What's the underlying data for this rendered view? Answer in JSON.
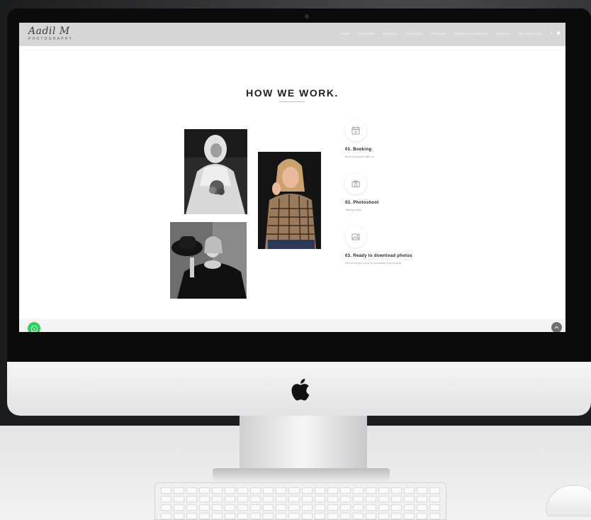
{
  "site": {
    "logo_script": "Aadil M",
    "logo_sub": "PHOTOGRAPHY"
  },
  "nav": {
    "items": [
      {
        "label": "HOME"
      },
      {
        "label": "OUR WORK"
      },
      {
        "label": "BOOKING"
      },
      {
        "label": "PACKAGES"
      },
      {
        "label": "ARTICLES"
      },
      {
        "label": "BEHIND THE CAMERA"
      },
      {
        "label": "CONTACT"
      },
      {
        "label": "TESTIMONIALS"
      }
    ],
    "social": [
      {
        "label": "f",
        "icon": "facebook-icon"
      },
      {
        "label": "▣",
        "icon": "instagram-icon"
      }
    ]
  },
  "section": {
    "title": "HOW WE WORK."
  },
  "steps": [
    {
      "title": "01.  Booking",
      "desc": "Book a session with us",
      "icon": "calendar-icon"
    },
    {
      "title": "02.  Photoshoot",
      "desc": "Taking action",
      "icon": "camera-icon"
    },
    {
      "title": "03.  Ready to download photos",
      "desc": "We email you a link to download your photos",
      "icon": "image-icon"
    }
  ],
  "photos": [
    {
      "name": "bride-photo",
      "desc": "black and white bride"
    },
    {
      "name": "hat-woman-photo",
      "desc": "black and white woman with hat"
    },
    {
      "name": "plaid-shirt-photo",
      "desc": "woman in plaid shirt"
    }
  ],
  "colors": {
    "nav_bg": "#d6d6d6",
    "whatsapp": "#2bd15a",
    "scroll_top": "#6f6f6f",
    "title": "#1f1f1f"
  },
  "icons": {
    "whatsapp": "whatsapp-icon",
    "scroll_top": "chevron-up-icon",
    "apple": "apple-logo-icon"
  }
}
